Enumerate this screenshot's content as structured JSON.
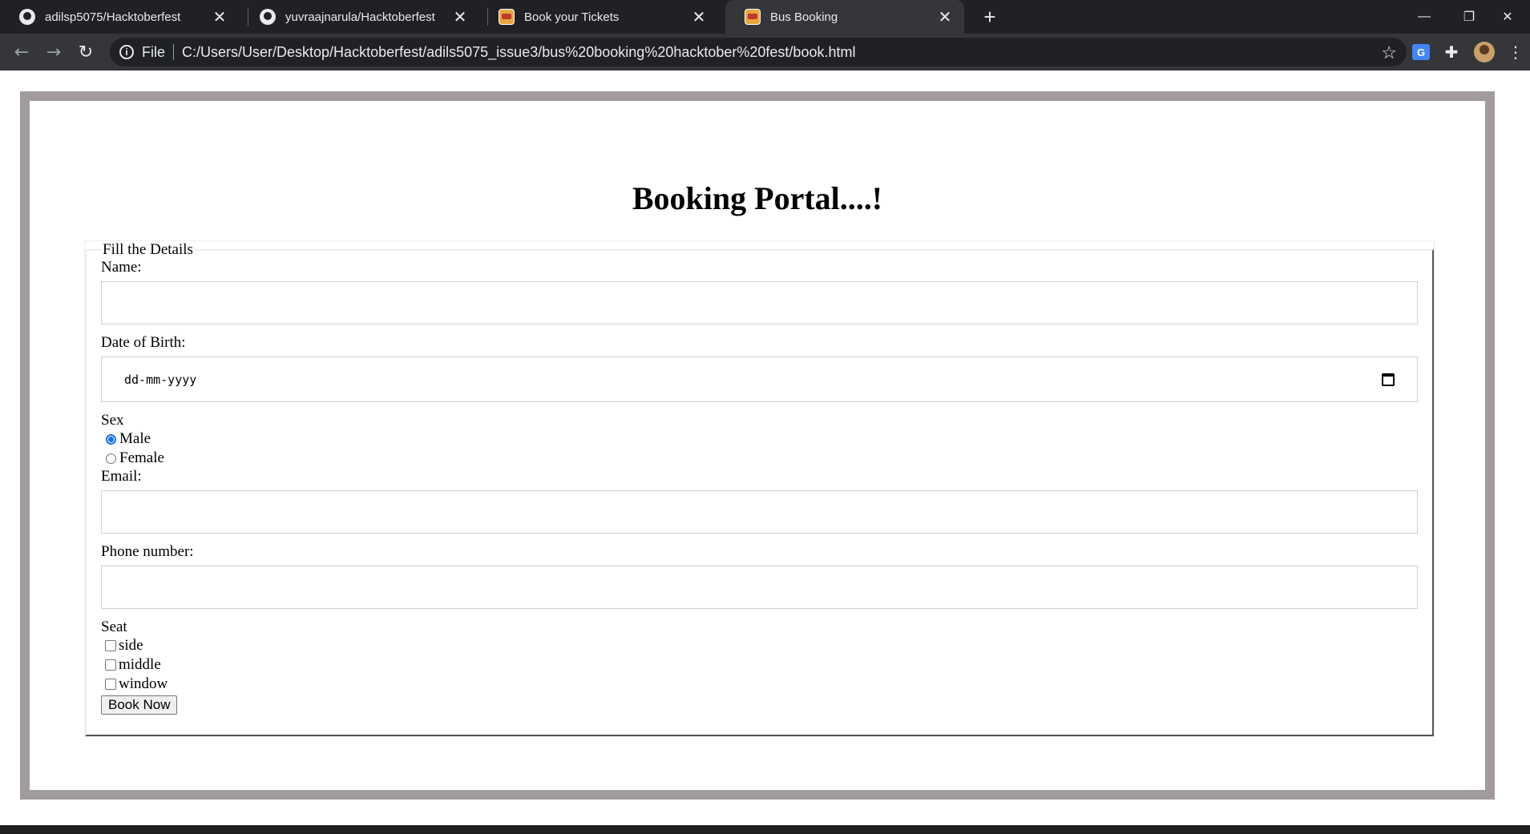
{
  "tabs": [
    {
      "title": "adilsp5075/Hacktoberfest",
      "icon": "github-icon",
      "active": false
    },
    {
      "title": "yuvraajnarula/Hacktoberfest",
      "icon": "github-icon",
      "active": false
    },
    {
      "title": "Book your Tickets",
      "icon": "bus-site-icon",
      "active": false
    },
    {
      "title": "Bus Booking",
      "icon": "bus-site-icon",
      "active": true
    }
  ],
  "tab_close_glyph": "✕",
  "new_tab_glyph": "+",
  "window_controls": {
    "minimize": "—",
    "restore": "❐",
    "close": "✕"
  },
  "toolbar": {
    "back": "←",
    "forward": "→",
    "reload": "↻",
    "scheme_label": "File",
    "url": "C:/Users/User/Desktop/Hacktoberfest/adils5075_issue3/bus%20booking%20hacktober%20fest/book.html",
    "star": "☆",
    "translate": "G",
    "extensions": "✚",
    "menu": "⋮"
  },
  "page": {
    "heading": "Booking Portal....!",
    "legend": "Fill the Details",
    "name_label": "Name:",
    "name_value": "",
    "dob_label": "Date of Birth:",
    "dob_placeholder": "dd-mm-yyyy",
    "sex_label": "Sex",
    "sex_options": [
      {
        "label": "Male",
        "checked": true
      },
      {
        "label": "Female",
        "checked": false
      }
    ],
    "email_label": "Email:",
    "email_value": "",
    "phone_label": "Phone number:",
    "phone_value": "",
    "seat_label": "Seat",
    "seat_options": [
      {
        "label": "side",
        "checked": false
      },
      {
        "label": "middle",
        "checked": false
      },
      {
        "label": "window",
        "checked": false
      }
    ],
    "submit_label": "Book Now"
  },
  "colors": {
    "chrome_dark": "#202124",
    "chrome_toolbar": "#35363a",
    "frame_border": "#a29b9b",
    "radio_accent": "#1a73e8"
  }
}
